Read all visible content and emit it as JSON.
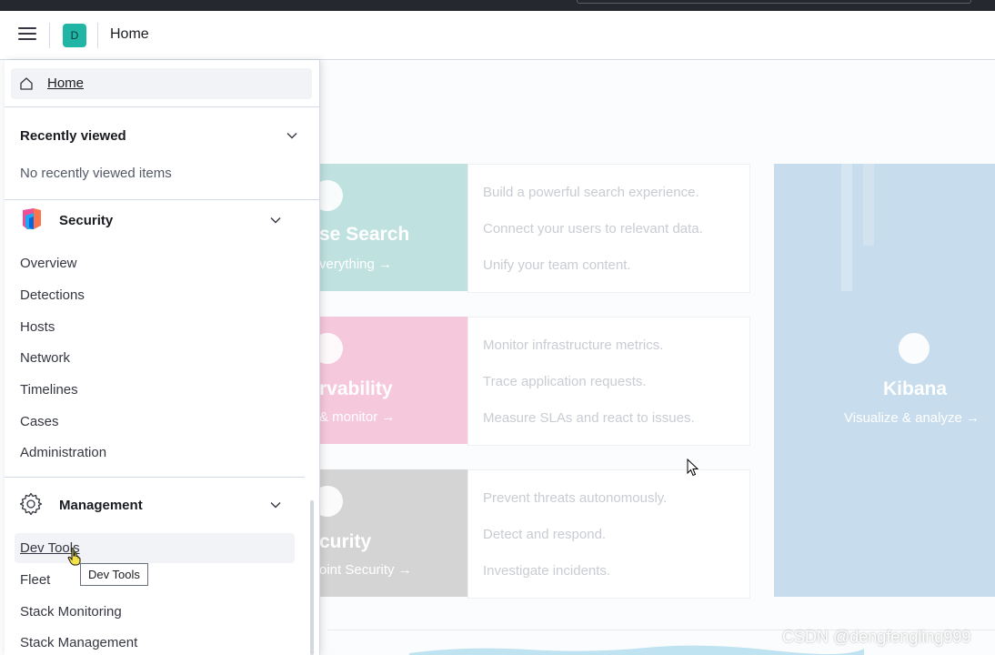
{
  "header": {
    "space_initial": "D",
    "breadcrumb": "Home"
  },
  "cards": [
    {
      "title_fragment": "se Search",
      "link_fragment": "verything →",
      "lines": [
        "Build a powerful search experience.",
        "Connect your users to relevant data.",
        "Unify your team content."
      ],
      "color": "#bfe1e0"
    },
    {
      "title_fragment": "rvability",
      "link_fragment": "& monitor →",
      "lines": [
        "Monitor infrastructure metrics.",
        "Trace application requests.",
        "Measure SLAs and react to issues."
      ],
      "color": "#f6c8dc"
    },
    {
      "title_fragment": "curity",
      "link_fragment": "oint Security →",
      "lines": [
        "Prevent threats autonomously.",
        "Detect and respond.",
        "Investigate incidents."
      ],
      "color": "#d4d4d4"
    }
  ],
  "kibana_card": {
    "title": "Kibana",
    "link": "Visualize & analyze →",
    "color": "#c7dcec"
  },
  "nav": {
    "home_label": "Home",
    "recent": {
      "title": "Recently viewed",
      "empty": "No recently viewed items"
    },
    "security": {
      "title": "Security",
      "items": [
        "Overview",
        "Detections",
        "Hosts",
        "Network",
        "Timelines",
        "Cases",
        "Administration"
      ]
    },
    "management": {
      "title": "Management",
      "items": [
        "Dev Tools",
        "Fleet",
        "Stack Monitoring",
        "Stack Management"
      ]
    }
  },
  "tooltip": "Dev Tools",
  "watermark": "CSDN @dengfengling999"
}
